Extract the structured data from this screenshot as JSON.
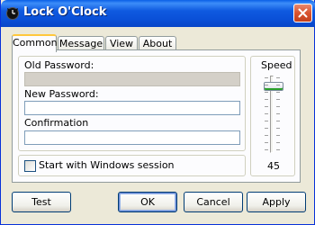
{
  "window": {
    "title": "Lock O'Clock"
  },
  "tabs": [
    {
      "label": "Common"
    },
    {
      "label": "Message"
    },
    {
      "label": "View"
    },
    {
      "label": "About"
    }
  ],
  "form": {
    "old_password_label": "Old Password:",
    "old_password_value": "",
    "new_password_label": "New Password:",
    "new_password_value": "",
    "confirmation_label": "Confirmation",
    "confirmation_value": "",
    "start_with_windows_label": "Start with Windows session",
    "start_with_windows_checked": false
  },
  "speed": {
    "label": "Speed",
    "value": "45"
  },
  "buttons": {
    "test": "Test",
    "ok": "OK",
    "cancel": "Cancel",
    "apply": "Apply"
  },
  "icons": {
    "app": "clock-icon",
    "close": "close-icon"
  },
  "colors": {
    "titlebar": "#0a5fe6",
    "close_button": "#d9532f",
    "active_tab_accent": "#ffc83c",
    "face": "#ece9d8"
  }
}
